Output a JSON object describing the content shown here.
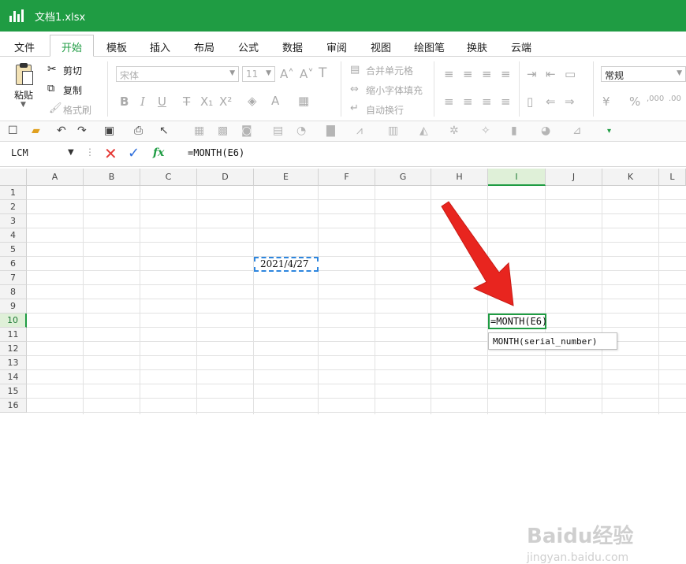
{
  "window": {
    "title": "文档1.xlsx"
  },
  "menu": {
    "items": [
      "文件",
      "开始",
      "模板",
      "插入",
      "布局",
      "公式",
      "数据",
      "审阅",
      "视图",
      "绘图笔",
      "换肤",
      "云端"
    ],
    "active_index": 1
  },
  "ribbon": {
    "paste_label": "粘贴",
    "cut_label": "剪切",
    "copy_label": "复制",
    "format_painter_label": "格式刷",
    "font_name": "宋体",
    "font_size": "11",
    "merge_label": "合并单元格",
    "shrink_label": "缩小字体填充",
    "wrap_label": "自动换行",
    "number_format": "常规"
  },
  "formula_bar": {
    "name_box": "LCM",
    "formula": "=MONTH(E6)"
  },
  "sheet": {
    "columns": [
      "A",
      "B",
      "C",
      "D",
      "E",
      "F",
      "G",
      "H",
      "I",
      "J",
      "K",
      "L"
    ],
    "rows": [
      "1",
      "2",
      "3",
      "4",
      "5",
      "6",
      "7",
      "8",
      "9",
      "10",
      "11",
      "12",
      "13",
      "14",
      "15",
      "16"
    ],
    "selected_column": "I",
    "selected_row": "10",
    "cell_e6": "2021/4/27",
    "cell_i10": "=MONTH(E6)",
    "tooltip": "MONTH(serial_number)"
  },
  "watermark": {
    "line1": "Baidu经验",
    "line2": "jingyan.baidu.com"
  },
  "colors": {
    "brand_green": "#1f9c43",
    "arrow_red": "#e8251f",
    "reference_blue": "#2e86de"
  }
}
